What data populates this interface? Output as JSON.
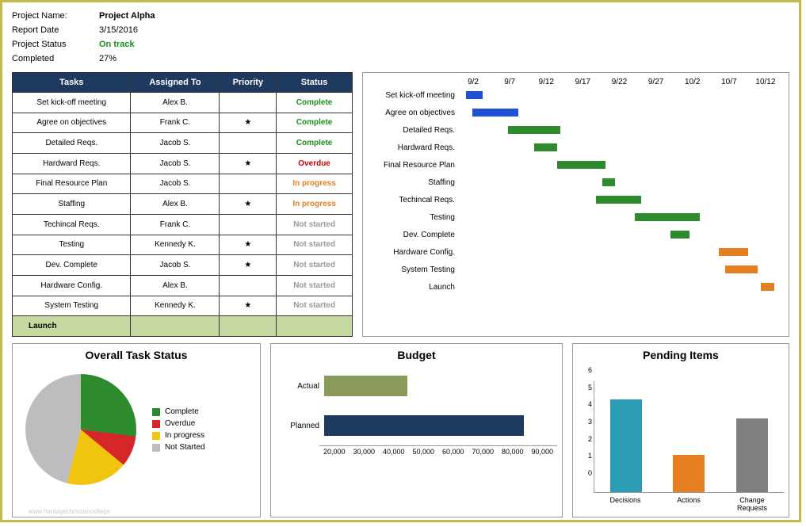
{
  "header": {
    "project_name_label": "Project Name:",
    "project_name": "Project Alpha",
    "report_date_label": "Report Date",
    "report_date": "3/15/2016",
    "project_status_label": "Project Status",
    "project_status": "On track",
    "completed_label": "Completed",
    "completed": "27%"
  },
  "table_headers": {
    "tasks": "Tasks",
    "assigned": "Assigned To",
    "priority": "Priority",
    "status": "Status"
  },
  "tasks": [
    {
      "name": "Set kick-off meeting",
      "assigned": "Alex B.",
      "priority": "",
      "status": "Complete",
      "status_class": "green"
    },
    {
      "name": "Agree on objectives",
      "assigned": "Frank C.",
      "priority": "★",
      "status": "Complete",
      "status_class": "green"
    },
    {
      "name": "Detailed Reqs.",
      "assigned": "Jacob S.",
      "priority": "",
      "status": "Complete",
      "status_class": "green"
    },
    {
      "name": "Hardward Reqs.",
      "assigned": "Jacob S.",
      "priority": "★",
      "status": "Overdue",
      "status_class": "red"
    },
    {
      "name": "Final Resource Plan",
      "assigned": "Jacob S.",
      "priority": "",
      "status": "In progress",
      "status_class": "orange"
    },
    {
      "name": "Staffing",
      "assigned": "Alex B.",
      "priority": "★",
      "status": "In progress",
      "status_class": "orange"
    },
    {
      "name": "Techincal Reqs.",
      "assigned": "Frank C.",
      "priority": "",
      "status": "Not started",
      "status_class": "gray"
    },
    {
      "name": "Testing",
      "assigned": "Kennedy K.",
      "priority": "★",
      "status": "Not started",
      "status_class": "gray"
    },
    {
      "name": "Dev. Complete",
      "assigned": "Jacob S.",
      "priority": "★",
      "status": "Not started",
      "status_class": "gray"
    },
    {
      "name": "Hardware Config.",
      "assigned": "Alex B.",
      "priority": "",
      "status": "Not started",
      "status_class": "gray"
    },
    {
      "name": "System Testing",
      "assigned": "Kennedy K.",
      "priority": "★",
      "status": "Not started",
      "status_class": "gray"
    }
  ],
  "launch_label": "Launch",
  "gantt": {
    "dates": [
      "9/2",
      "9/7",
      "9/12",
      "9/17",
      "9/22",
      "9/27",
      "10/2",
      "10/7",
      "10/12"
    ],
    "rows": [
      {
        "label": "Set kick-off meeting",
        "color": "blue",
        "left": 2,
        "width": 5
      },
      {
        "label": "Agree on objectives",
        "color": "blue",
        "left": 4,
        "width": 14
      },
      {
        "label": "Detailed Reqs.",
        "color": "greenb",
        "left": 15,
        "width": 16
      },
      {
        "label": "Hardward Reqs.",
        "color": "greenb",
        "left": 23,
        "width": 7
      },
      {
        "label": "Final Resource Plan",
        "color": "greenb",
        "left": 30,
        "width": 15
      },
      {
        "label": "Staffing",
        "color": "greenb",
        "left": 44,
        "width": 4
      },
      {
        "label": "Techincal Reqs.",
        "color": "greenb",
        "left": 42,
        "width": 14
      },
      {
        "label": "Testing",
        "color": "greenb",
        "left": 54,
        "width": 20
      },
      {
        "label": "Dev. Complete",
        "color": "greenb",
        "left": 65,
        "width": 6
      },
      {
        "label": "Hardware Config.",
        "color": "orangeb",
        "left": 80,
        "width": 9
      },
      {
        "label": "System Testing",
        "color": "orangeb",
        "left": 82,
        "width": 10
      },
      {
        "label": "Launch",
        "color": "orangeb",
        "left": 93,
        "width": 4
      }
    ]
  },
  "pie": {
    "title": "Overall Task Status",
    "legend": [
      {
        "label": "Complete",
        "color": "#2e8b2e"
      },
      {
        "label": "Overdue",
        "color": "#d62728"
      },
      {
        "label": "In progress",
        "color": "#f1c40f"
      },
      {
        "label": "Not Started",
        "color": "#bdbdbd"
      }
    ]
  },
  "budget": {
    "title": "Budget",
    "bars": [
      {
        "label": "Actual",
        "value": 45000,
        "color": "#8a9a5b"
      },
      {
        "label": "Planned",
        "value": 80000,
        "color": "#1f3a5f"
      }
    ],
    "axis": [
      "20,000",
      "30,000",
      "40,000",
      "50,000",
      "60,000",
      "70,000",
      "80,000",
      "90,000"
    ]
  },
  "pending": {
    "title": "Pending Items",
    "ymax": 6,
    "yticks": [
      "6",
      "5",
      "4",
      "3",
      "2",
      "1",
      "0"
    ],
    "bars": [
      {
        "label": "Decisions",
        "value": 5,
        "color": "#2a9db5"
      },
      {
        "label": "Actions",
        "value": 2,
        "color": "#e67e22"
      },
      {
        "label": "Change Requests",
        "value": 4,
        "color": "#808080"
      }
    ]
  },
  "chart_data": [
    {
      "type": "pie",
      "title": "Overall Task Status",
      "categories": [
        "Complete",
        "Overdue",
        "In progress",
        "Not Started"
      ],
      "values": [
        27,
        9,
        18,
        46
      ]
    },
    {
      "type": "bar",
      "title": "Budget",
      "orientation": "horizontal",
      "categories": [
        "Actual",
        "Planned"
      ],
      "values": [
        45000,
        80000
      ],
      "xlim": [
        20000,
        90000
      ]
    },
    {
      "type": "bar",
      "title": "Pending Items",
      "categories": [
        "Decisions",
        "Actions",
        "Change Requests"
      ],
      "values": [
        5,
        2,
        4
      ],
      "ylim": [
        0,
        6
      ]
    },
    {
      "type": "gantt",
      "title": "Schedule",
      "x_ticks": [
        "9/2",
        "9/7",
        "9/12",
        "9/17",
        "9/22",
        "9/27",
        "10/2",
        "10/7",
        "10/12"
      ],
      "tasks": [
        {
          "name": "Set kick-off meeting",
          "start": "9/2",
          "end": "9/3"
        },
        {
          "name": "Agree on objectives",
          "start": "9/3",
          "end": "9/8"
        },
        {
          "name": "Detailed Reqs.",
          "start": "9/8",
          "end": "9/14"
        },
        {
          "name": "Hardward Reqs.",
          "start": "9/11",
          "end": "9/14"
        },
        {
          "name": "Final Resource Plan",
          "start": "9/14",
          "end": "9/20"
        },
        {
          "name": "Staffing",
          "start": "9/20",
          "end": "9/21"
        },
        {
          "name": "Techincal Reqs.",
          "start": "9/19",
          "end": "9/24"
        },
        {
          "name": "Testing",
          "start": "9/24",
          "end": "10/2"
        },
        {
          "name": "Dev. Complete",
          "start": "9/28",
          "end": "9/30"
        },
        {
          "name": "Hardware Config.",
          "start": "10/4",
          "end": "10/8"
        },
        {
          "name": "System Testing",
          "start": "10/5",
          "end": "10/9"
        },
        {
          "name": "Launch",
          "start": "10/10",
          "end": "10/11"
        }
      ]
    }
  ]
}
